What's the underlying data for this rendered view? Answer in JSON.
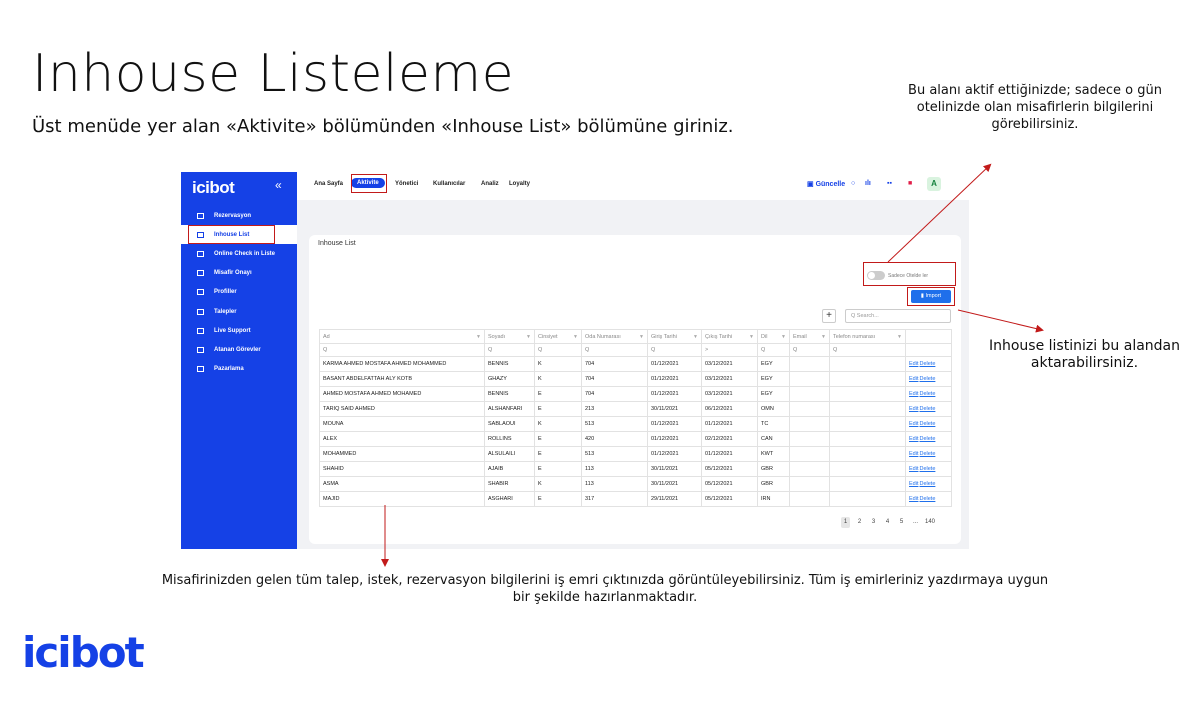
{
  "slide": {
    "title": "Inhouse Listeleme",
    "subtitle": "Üst menüde yer alan «Aktivite» bölümünden «Inhouse List» bölümüne giriniz.",
    "note_top": "Bu alanı aktif ettiğinizde; sadece o gün otelinizde olan misafirlerin bilgilerini görebilirsiniz.",
    "note_right": "Inhouse listinizi bu alandan aktarabilirsiniz.",
    "note_bottom": "Misafirinizden gelen tüm talep, istek, rezervasyon bilgilerini iş emri çıktınızda görüntüleyebilirsiniz. Tüm iş emirleriniz yazdırmaya uygun bir şekilde hazırlanmaktadır.",
    "brand": "icibot",
    "highlight_color": "#c21a1a"
  },
  "app": {
    "logo": "icibot",
    "collapse_icon": "«",
    "brand_color": "#1541e6",
    "sidebar": [
      {
        "label": "Rezervasyon",
        "icon": "calendar-icon"
      },
      {
        "label": "Inhouse List",
        "icon": "calendar-icon",
        "active": true
      },
      {
        "label": "Online Check in Liste",
        "icon": "calendar-icon"
      },
      {
        "label": "Misafir Onayı",
        "icon": "calendar-icon"
      },
      {
        "label": "Profiller",
        "icon": "calendar-icon"
      },
      {
        "label": "Talepler",
        "icon": "calendar-icon"
      },
      {
        "label": "Live Support",
        "icon": "calendar-icon"
      },
      {
        "label": "Atanan Görevler",
        "icon": "calendar-icon"
      },
      {
        "label": "Pazarlama",
        "icon": "calendar-icon"
      }
    ],
    "topnav": [
      "Ana Sayfa",
      "Aktivite",
      "Yönetici",
      "Kullanıcılar",
      "Analiz",
      "Loyalty"
    ],
    "topnav_active": "Aktivite",
    "guncelle": "Güncelle",
    "avatar": "A",
    "card_title": "Inhouse List",
    "toggle_label": "Sadece Otelde ler",
    "import_label": "Import",
    "plus": "+",
    "search_placeholder": "Q  Search...",
    "columns": [
      "Ad",
      "Soyadı",
      "Cinsiyet",
      "Oda Numarası",
      "Giriş Tarihi",
      "Çıkış Tarihi",
      "Dil",
      "Email",
      "Telefon numarası",
      ""
    ],
    "filter_row": [
      "Q",
      "Q",
      "Q",
      "Q",
      "Q",
      ">",
      "Q",
      "Q",
      "Q",
      ""
    ],
    "rows": [
      [
        "KARMA AHMED MOSTAFA AHMED MOHAMMED",
        "BENNIS",
        "K",
        "704",
        "01/12/2021",
        "03/12/2021",
        "EGY",
        "",
        ""
      ],
      [
        "BASANT ABDELFATTAH ALY KOTB",
        "GHAZY",
        "K",
        "704",
        "01/12/2021",
        "03/12/2021",
        "EGY",
        "",
        ""
      ],
      [
        "AHMED MOSTAFA AHMED MOHAMED",
        "BENNIS",
        "E",
        "704",
        "01/12/2021",
        "03/12/2021",
        "EGY",
        "",
        ""
      ],
      [
        "TARIQ SAID AHMED",
        "ALSHANFARI",
        "E",
        "213",
        "30/11/2021",
        "06/12/2021",
        "OMN",
        "",
        ""
      ],
      [
        "MOUNA",
        "SABLAOUI",
        "K",
        "513",
        "01/12/2021",
        "01/12/2021",
        "TC",
        "",
        ""
      ],
      [
        "ALEX",
        "ROLLINS",
        "E",
        "420",
        "01/12/2021",
        "02/12/2021",
        "CAN",
        "",
        ""
      ],
      [
        "MOHAMMED",
        "ALSULAILI",
        "E",
        "513",
        "01/12/2021",
        "01/12/2021",
        "KWT",
        "",
        ""
      ],
      [
        "SHAHID",
        "AJAIB",
        "E",
        "113",
        "30/11/2021",
        "05/12/2021",
        "GBR",
        "",
        ""
      ],
      [
        "ASMA",
        "SHABIR",
        "K",
        "113",
        "30/11/2021",
        "05/12/2021",
        "GBR",
        "",
        ""
      ],
      [
        "MAJID",
        "ASGHARI",
        "E",
        "317",
        "29/11/2021",
        "05/12/2021",
        "IRN",
        "",
        ""
      ]
    ],
    "edit_label": "Edit",
    "delete_label": "Delete",
    "pager": [
      "1",
      "2",
      "3",
      "4",
      "5",
      "...",
      "140"
    ],
    "pager_active": "1"
  }
}
